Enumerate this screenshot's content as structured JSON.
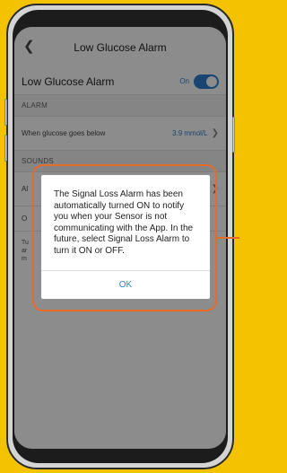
{
  "nav": {
    "title": "Low Glucose Alarm"
  },
  "main_toggle": {
    "label": "Low Glucose Alarm",
    "state": "On"
  },
  "alarm_section": {
    "header": "ALARM",
    "threshold_label": "When glucose goes below",
    "threshold_value": "3.9 mmol/L"
  },
  "sounds_section": {
    "header": "SOUNDS",
    "row_label_fragment": "Al",
    "row_value_fragment": "3"
  },
  "override_section": {
    "label_fragment": "O",
    "lines": [
      "Tu",
      "ar",
      "m"
    ]
  },
  "dialog": {
    "message": "The Signal Loss Alarm has been automatically turned ON to notify you when your Sensor is not communicating with the App. In the future, select Signal Loss Alarm to turn it ON or OFF.",
    "ok_label": "OK"
  },
  "colors": {
    "accent": "#2d7fd0",
    "highlight": "#e86a2a",
    "background": "#f3c200"
  }
}
